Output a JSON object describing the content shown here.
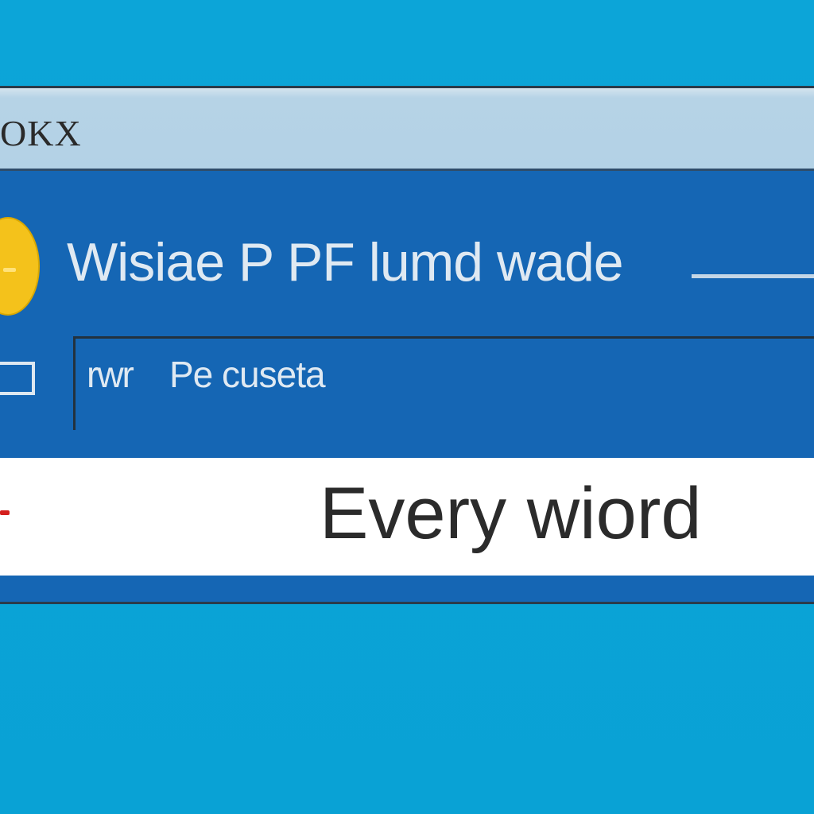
{
  "window": {
    "title": "OKX"
  },
  "header": {
    "heading": "Wisiae P PF lumd wade"
  },
  "field": {
    "prefix": "rwr",
    "value": "Pe cuseta"
  },
  "banner": {
    "text": "Every wiord"
  },
  "icons": {
    "status": "yellow-circle-icon",
    "checkbox": "checkbox-icon",
    "alert": "red-dash-icon"
  },
  "colors": {
    "background": "#0aa3d6",
    "window": "#1566b4",
    "titlebar": "#b3d2e6",
    "accent_yellow": "#f4c21b",
    "alert_red": "#d4201e"
  }
}
